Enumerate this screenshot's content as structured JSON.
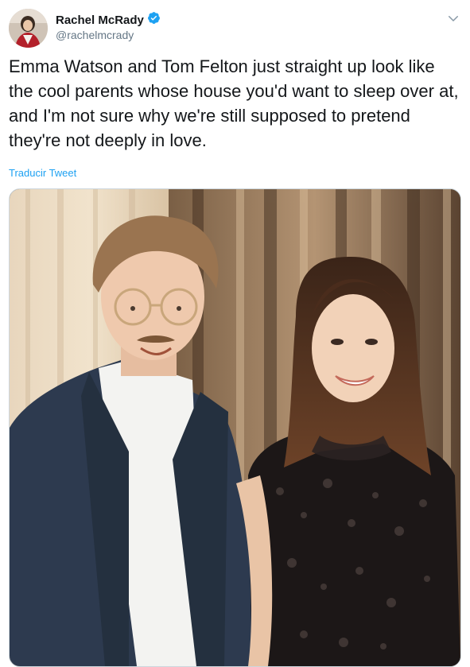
{
  "user": {
    "display_name": "Rachel McRady",
    "handle": "@rachelmcrady",
    "verified": true,
    "verified_color": "#1da1f2"
  },
  "tweet": {
    "text": "Emma Watson and Tom Felton just straight up look like the cool parents whose house you'd want to sleep over at, and I'm not sure why we're still supposed to pretend they're not deeply in love.",
    "translate_label": "Traducir Tweet"
  },
  "icons": {
    "verified": "verified-badge-icon",
    "menu": "chevron-down-icon"
  },
  "colors": {
    "link": "#1da1f2",
    "secondary_text": "#657786",
    "primary_text": "#14171a"
  }
}
